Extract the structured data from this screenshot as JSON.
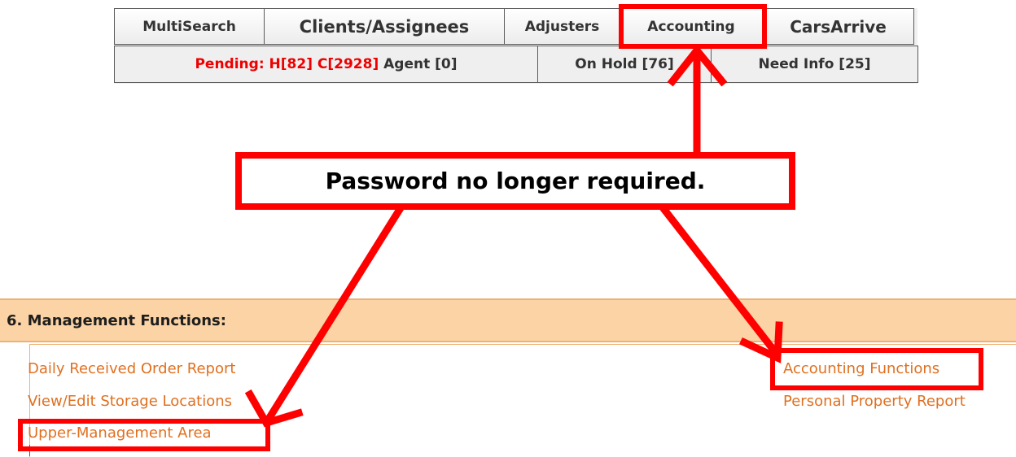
{
  "nav": {
    "tabs": [
      {
        "label": "MultiSearch"
      },
      {
        "label": "Clients/Assignees"
      },
      {
        "label": "Adjusters"
      },
      {
        "label": "Accounting"
      },
      {
        "label": "CarsArrive"
      }
    ],
    "status": {
      "pending_text": "Pending: H[82] C[2928]",
      "agent_text": "Agent [0]",
      "on_hold": "On Hold [76]",
      "need_info": "Need Info [25]"
    }
  },
  "callout": {
    "text": "Password no longer required."
  },
  "management": {
    "header": "6. Management Functions:",
    "links_left": [
      "Daily Received Order Report",
      "View/Edit Storage Locations",
      "Upper-Management Area"
    ],
    "links_right": [
      "Accounting Functions",
      "Personal Property Report"
    ]
  },
  "colors": {
    "highlight": "#ff0000",
    "link": "#e07020",
    "header_bg": "#fbd3a4",
    "pending": "#ee0000"
  }
}
